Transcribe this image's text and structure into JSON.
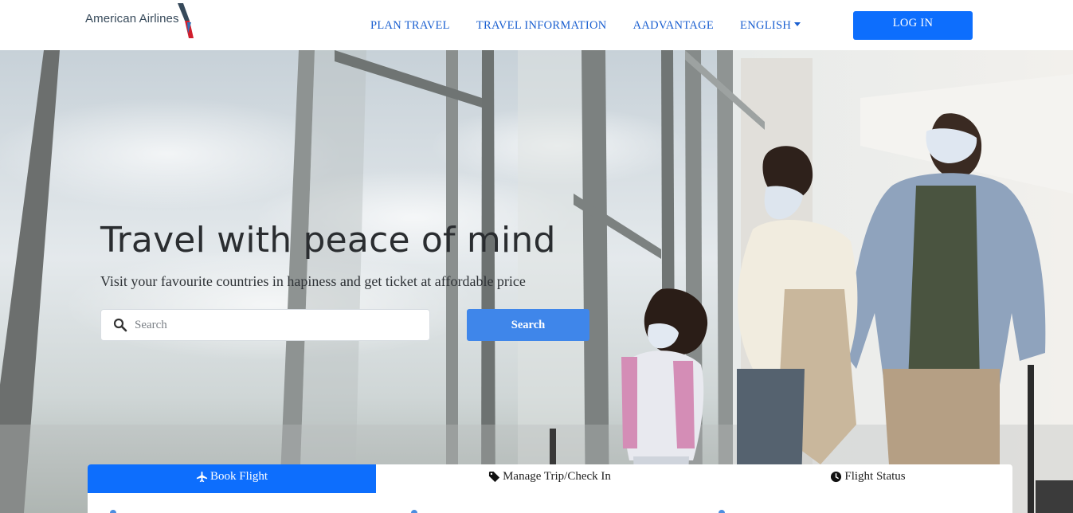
{
  "brand": {
    "name": "American Airlines"
  },
  "nav": {
    "links": [
      {
        "label": "PLAN TRAVEL"
      },
      {
        "label": "TRAVEL INFORMATION"
      },
      {
        "label": "AADVANTAGE"
      },
      {
        "label": "ENGLISH"
      }
    ],
    "login_label": "LOG IN"
  },
  "hero": {
    "title": "Travel with peace of mind",
    "subtitle": "Visit your favourite countries in hapiness and get ticket at affordable price",
    "search_placeholder": "Search",
    "search_button": "Search"
  },
  "tabs": [
    {
      "label": "Book Flight",
      "icon": "plane-icon",
      "active": true
    },
    {
      "label": "Manage Trip/Check In",
      "icon": "tag-icon",
      "active": false
    },
    {
      "label": "Flight Status",
      "icon": "clock-icon",
      "active": false
    }
  ],
  "colors": {
    "primary": "#0d6efd",
    "nav_link": "#1a5fd0",
    "search_button": "#3f86ea",
    "title_text": "#2a2d30"
  }
}
